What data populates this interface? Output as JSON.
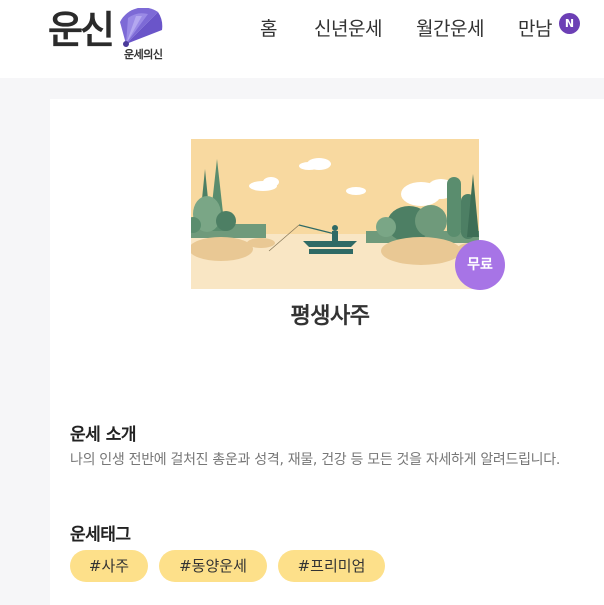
{
  "header": {
    "logo_main": "운신",
    "logo_sub": "운세의신",
    "nav": [
      "홈",
      "신년운세",
      "월간운세",
      "만남"
    ],
    "badge": "N"
  },
  "product": {
    "free_label": "무료",
    "title": "평생사주"
  },
  "intro": {
    "heading": "운세 소개",
    "description": "나의 인생 전반에 걸처진 총운과 성격, 재물, 건강 등 모든 것을 자세하게 알려드립니다."
  },
  "tags": {
    "heading": "운세태그",
    "items": [
      "#사주",
      "#동양운세",
      "#프리미엄"
    ]
  },
  "colors": {
    "badge_purple": "#6c3fb5",
    "free_purple": "#a774e6",
    "tag_yellow": "#fde08a"
  }
}
